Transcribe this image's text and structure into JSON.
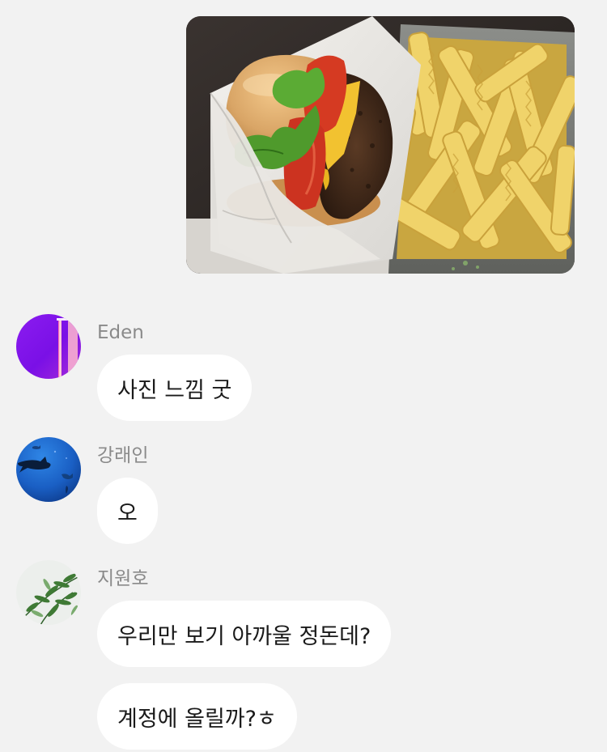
{
  "photo_message": {
    "alt_icon": "burger-and-fries-photo"
  },
  "messages": [
    {
      "sender": "Eden",
      "avatar_icon": "purple-neon-avatar",
      "bubbles": [
        "사진 느낌 굿"
      ]
    },
    {
      "sender": "강래인",
      "avatar_icon": "shark-ocean-avatar",
      "bubbles": [
        "오"
      ]
    },
    {
      "sender": "지원호",
      "avatar_icon": "green-leaves-avatar",
      "bubbles": [
        "우리만 보기 아까울 정돈데?",
        "계정에 올릴까?ㅎ"
      ]
    }
  ],
  "colors": {
    "background": "#f2f2f2",
    "bubble": "#ffffff",
    "sender_name": "#8a8a8a",
    "message_text": "#1a1a1a"
  }
}
